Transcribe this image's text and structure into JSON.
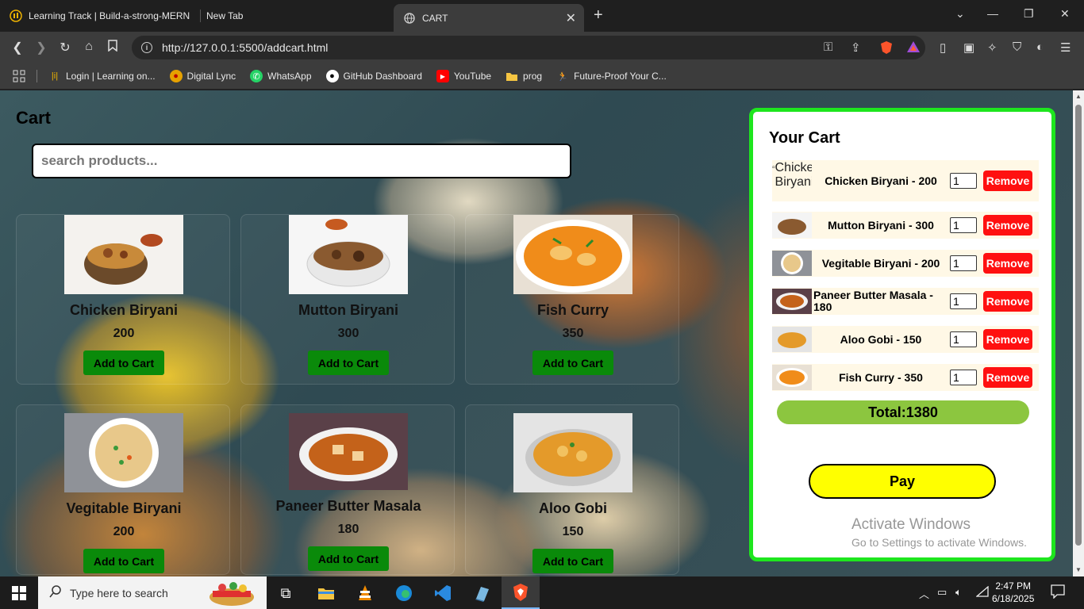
{
  "browser": {
    "tabs": [
      {
        "title": "Learning Track | Build-a-strong-MERN"
      },
      {
        "title": "New Tab"
      },
      {
        "title": "CART"
      }
    ],
    "url": "http://127.0.0.1:5500/addcart.html",
    "bookmarks": [
      {
        "label": "Login | Learning on..."
      },
      {
        "label": "Digital Lync"
      },
      {
        "label": "WhatsApp"
      },
      {
        "label": "GitHub Dashboard"
      },
      {
        "label": "YouTube"
      },
      {
        "label": "prog"
      },
      {
        "label": "Future-Proof Your C..."
      }
    ]
  },
  "page": {
    "title": "Cart",
    "search_placeholder": "search products...",
    "add_label": "Add to Cart",
    "products": [
      {
        "name": "Chicken Biryani",
        "price": "200"
      },
      {
        "name": "Mutton Biryani",
        "price": "300"
      },
      {
        "name": "Fish Curry",
        "price": "350"
      },
      {
        "name": "Vegitable Biryani",
        "price": "200"
      },
      {
        "name": "Paneer Butter Masala",
        "price": "180"
      },
      {
        "name": "Aloo Gobi",
        "price": "150"
      }
    ]
  },
  "cart": {
    "heading": "Your Cart",
    "broken_image_alt": "Chicken Biryani",
    "remove_label": "Remove",
    "items": [
      {
        "label": "Chicken Biryani - 200",
        "qty": "1"
      },
      {
        "label": "Mutton Biryani - 300",
        "qty": "1"
      },
      {
        "label": "Vegitable Biryani - 200",
        "qty": "1"
      },
      {
        "label": "Paneer Butter Masala - 180",
        "qty": "1"
      },
      {
        "label": "Aloo Gobi - 150",
        "qty": "1"
      },
      {
        "label": "Fish Curry - 350",
        "qty": "1"
      }
    ],
    "total": "Total:1380",
    "pay_label": "Pay"
  },
  "watermark": {
    "line1": "Activate Windows",
    "line2": "Go to Settings to activate Windows."
  },
  "taskbar": {
    "search_placeholder": "Type here to search",
    "time": "2:47 PM",
    "date": "6/18/2025"
  }
}
